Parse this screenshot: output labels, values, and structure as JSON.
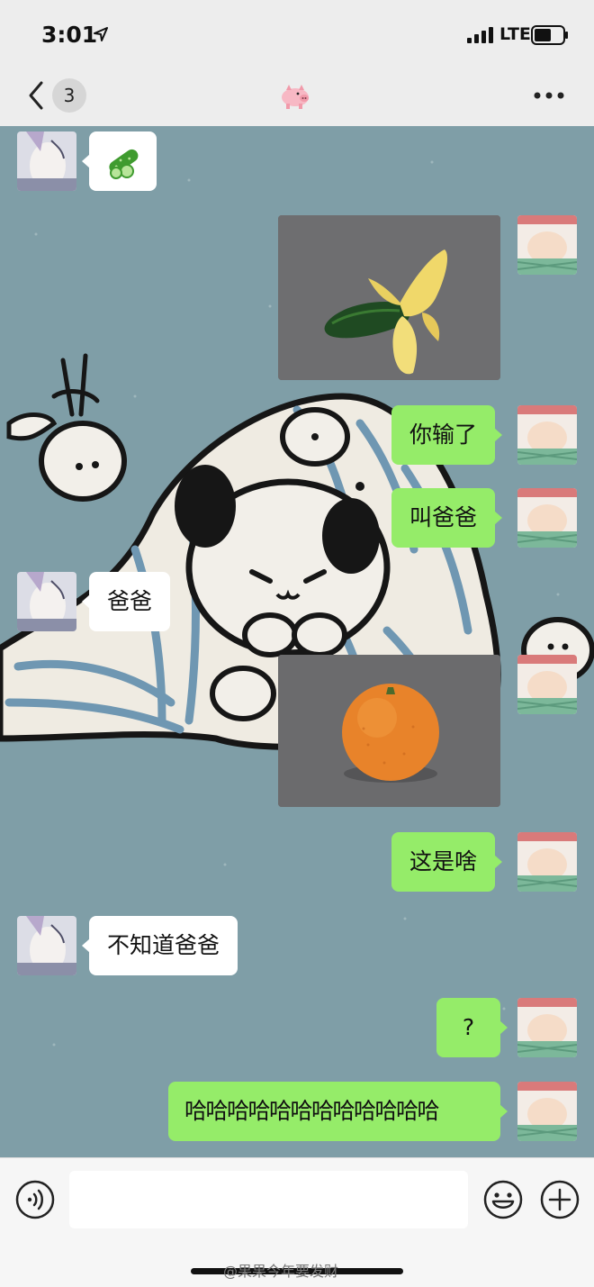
{
  "status_bar": {
    "time": "3:01",
    "network": "LTE"
  },
  "nav": {
    "unread_count": "3",
    "title_icon": "pig-emoji-icon",
    "more_icon": "more-dots-icon"
  },
  "messages": [
    {
      "from": "other",
      "type": "emoji",
      "content": "cucumber-emoji"
    },
    {
      "from": "me",
      "type": "image",
      "content": "banana-peel-cucumber-photo"
    },
    {
      "from": "me",
      "type": "text",
      "text": "你输了"
    },
    {
      "from": "me",
      "type": "text",
      "text": "叫爸爸"
    },
    {
      "from": "other",
      "type": "text",
      "text": "爸爸"
    },
    {
      "from": "me",
      "type": "image",
      "content": "orange-photo"
    },
    {
      "from": "me",
      "type": "text",
      "text": "这是啥"
    },
    {
      "from": "other",
      "type": "text",
      "text": "不知道爸爸"
    },
    {
      "from": "me",
      "type": "text",
      "text": "?"
    },
    {
      "from": "me",
      "type": "text",
      "text": "哈哈哈哈哈哈哈哈哈哈哈哈"
    }
  ],
  "input_bar": {
    "voice_icon": "voice-icon",
    "emoji_icon": "emoji-icon",
    "plus_icon": "plus-icon"
  },
  "watermark": "@果果今年要发财",
  "colors": {
    "chat_bg": "#7f9ea7",
    "bubble_out": "#95ec69",
    "bubble_in": "#ffffff",
    "bar_bg": "#ededed"
  }
}
